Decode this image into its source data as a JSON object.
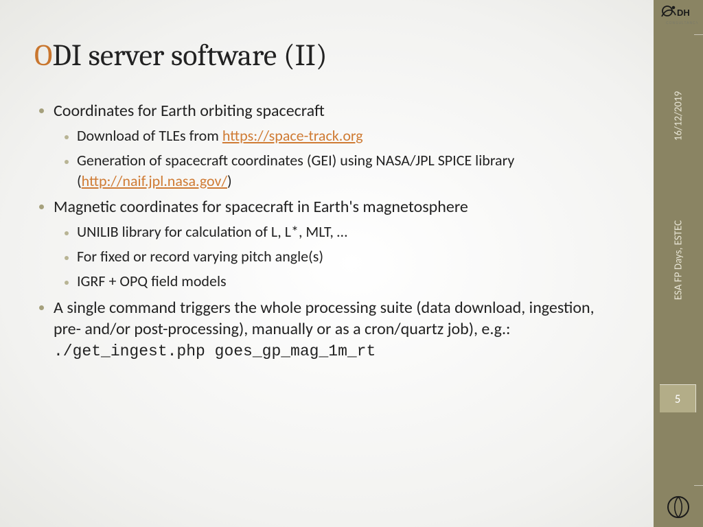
{
  "title_accent_char": "O",
  "title_rest": "DI server software (II)",
  "bullets": {
    "b1": "Coordinates for Earth orbiting spacecraft",
    "b1_1a": "Download of TLEs from ",
    "b1_1_link": "https://space-track.org",
    "b1_2a": "Generation of spacecraft coordinates (GEI) using NASA/JPL SPICE library (",
    "b1_2_link": "http://naif.jpl.nasa.gov/",
    "b1_2b": ")",
    "b2": "Magnetic coordinates for spacecraft in Earth's magnetosphere",
    "b2_1": "UNILIB library for calculation of L, L*, MLT, …",
    "b2_2": "For fixed or record varying pitch angle(s)",
    "b2_3": "IGRF + OPQ field models",
    "b3a": "A single command triggers the whole processing suite (data download, ingestion, pre- and/or post-processing), manually or as a cron/quartz job), e.g.:",
    "b3_cmd": "./get_ingest.php goes_gp_mag_1m_rt"
  },
  "sidebar": {
    "date": "16/12/2019",
    "event": "ESA FP Days, ESTEC",
    "page": "5",
    "logo_text": "DH",
    "logo_sub": "CONSULTANCY"
  }
}
